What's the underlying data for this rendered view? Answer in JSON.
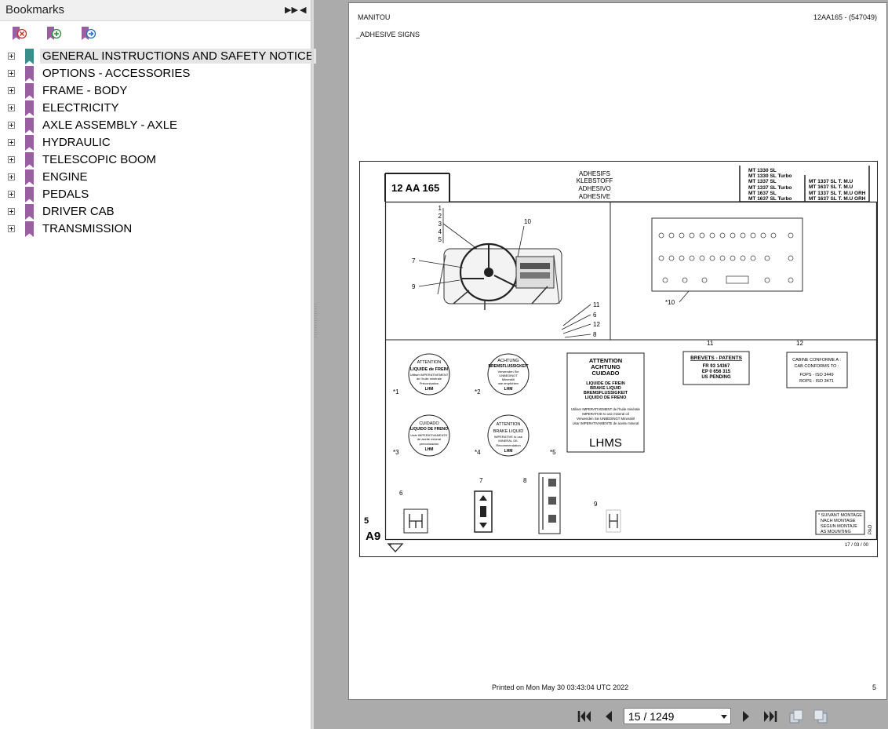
{
  "sidebar": {
    "title": "Bookmarks",
    "collapse_label": "▶▶",
    "close_label": "◀",
    "toolbar": [
      {
        "name": "delete-bookmark-icon"
      },
      {
        "name": "add-bookmark-icon"
      },
      {
        "name": "goto-bookmark-icon"
      }
    ],
    "items": [
      {
        "label": "GENERAL INSTRUCTIONS AND SAFETY NOTICE",
        "selected": true
      },
      {
        "label": "OPTIONS - ACCESSORIES"
      },
      {
        "label": "FRAME - BODY"
      },
      {
        "label": "ELECTRICITY"
      },
      {
        "label": "AXLE ASSEMBLY - AXLE"
      },
      {
        "label": "HYDRAULIC"
      },
      {
        "label": "TELESCOPIC BOOM"
      },
      {
        "label": "ENGINE"
      },
      {
        "label": "PEDALS"
      },
      {
        "label": "DRIVER CAB"
      },
      {
        "label": "TRANSMISSION"
      }
    ],
    "colors": {
      "selected_bookmark": "#3a8f8c",
      "bookmark": "#9a5fa0"
    }
  },
  "document": {
    "header_left": "MANITOU",
    "header_right": "12AA165 - (547049)",
    "section_title": "_ADHESIVE SIGNS",
    "footer_printed": "Printed on   Mon May 30 03:43:04 UTC 2022",
    "footer_page": "5",
    "drawing": {
      "code": "12 AA 165",
      "titles": [
        "ADHESIFS",
        "KLEBSTOFF",
        "ADHESIVO",
        "ADHESIVE"
      ],
      "models_left": [
        "MT 1330 SL",
        "MT 1330 SL Turbo",
        "MT 1337 SL",
        "MT 1337 SL Turbo",
        "MT 1637 SL",
        "MT 1637 SL Turbo"
      ],
      "models_right": [
        "MT 1337 SL T. M.U",
        "MT 1637 SL T. M.U",
        "MT 1337 SL T. M.U ORH",
        "MT 1637 SL T. M.U ORH"
      ],
      "callouts_top": [
        "1",
        "2",
        "3",
        "4",
        "5"
      ],
      "callout_10": "10",
      "callout_7": "7",
      "callout_9": "9",
      "callouts_right": [
        "11",
        "6",
        "12",
        "8"
      ],
      "sticker_10_label": "*10",
      "label1": {
        "num": "*1",
        "lines": [
          "ATTENTION",
          "LIQUIDE de FREIN",
          "Utiliser IMPERATIVEMENT",
          "de l'huile minérale",
          "Préconisation",
          "LHM"
        ]
      },
      "label2": {
        "num": "*2",
        "lines": [
          "ACHTUNG",
          "BREMSFLUSSIGKEIT",
          "Verwenden Sie",
          "UNBEDINGT",
          "Mineralöl",
          "wie empfohlen",
          "LHM"
        ]
      },
      "label3": {
        "num": "*3",
        "lines": [
          "CUIDADO",
          "LIQUIDO DE FRENO",
          "Usar IMPERATIVAMENTE",
          "de aceite mineral",
          "preconización",
          "LHM"
        ]
      },
      "label4": {
        "num": "*4",
        "lines": [
          "ATTENTION",
          "BRAKE LIQUID",
          "IMPERATIVE to use",
          "MINERAL OIL",
          "Recommendation",
          "LHM"
        ]
      },
      "label5": {
        "num": "*5",
        "lines": [
          "ATTENTION",
          "ACHTUNG",
          "CUIDADO",
          "LIQUIDE DE FREIN",
          "BRAKE LIQUID",
          "BREMSFLUSSIGKEIT",
          "LIQUIDO DE FRENO",
          "Utiliser IMPERATIVEMENT de l'huile minérale",
          "IMPERATIVE to use mineral oil",
          "Verwenden Sie UNBEDINGT Mineralöl",
          "Usar IMPERATIVAMENTE de aceite mineral",
          "LHMS"
        ]
      },
      "label11": {
        "num": "11",
        "lines": [
          "BREVETS - PATENTS",
          "FR 93 14367",
          "EP 0 656 315",
          "US PENDING"
        ]
      },
      "label12": {
        "num": "12",
        "lines": [
          "CABINE CONFORME A :",
          "CAB CONFORMS TO :",
          "FOPS - ISO 3449",
          "ROPS - ISO 3471"
        ]
      },
      "label6": "6",
      "label7": "7",
      "label8": "8",
      "label9": "9",
      "note_lines": [
        "* SUIVANT MONTAGE",
        "NACH MONTAGE",
        "SEGUN MONTAJE",
        "AS MOUNTING"
      ],
      "sheet_num": "5",
      "sheet_code": "A9",
      "date": "17 / 03 / 00",
      "side_code": "PAO"
    }
  },
  "navbar": {
    "page_value": "15 / 1249"
  }
}
